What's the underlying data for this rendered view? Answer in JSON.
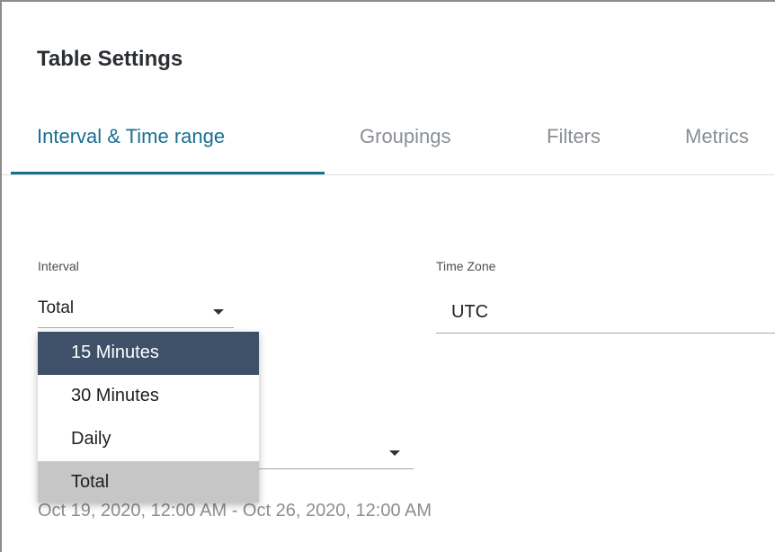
{
  "title": "Table Settings",
  "tabs": [
    {
      "label": "Interval & Time range",
      "active": true
    },
    {
      "label": "Groupings",
      "active": false
    },
    {
      "label": "Filters",
      "active": false
    },
    {
      "label": "Metrics",
      "active": false
    }
  ],
  "interval": {
    "label": "Interval",
    "value": "Total",
    "options": [
      {
        "label": "15 Minutes",
        "state": "hover"
      },
      {
        "label": "30 Minutes",
        "state": "normal"
      },
      {
        "label": "Daily",
        "state": "normal"
      },
      {
        "label": "Total",
        "state": "selected"
      }
    ]
  },
  "time_zone": {
    "label": "Time Zone",
    "value": "UTC"
  },
  "time_range": {
    "value": "",
    "display": "Oct 19, 2020, 12:00 AM - Oct 26, 2020, 12:00 AM"
  },
  "colors": {
    "accent": "#1a6f90",
    "option_hover_bg": "#3e5168",
    "option_selected_bg": "#c6c6c6",
    "muted_text": "#8a8f94"
  },
  "icons": {
    "dropdown_caret": "caret-down-icon"
  }
}
